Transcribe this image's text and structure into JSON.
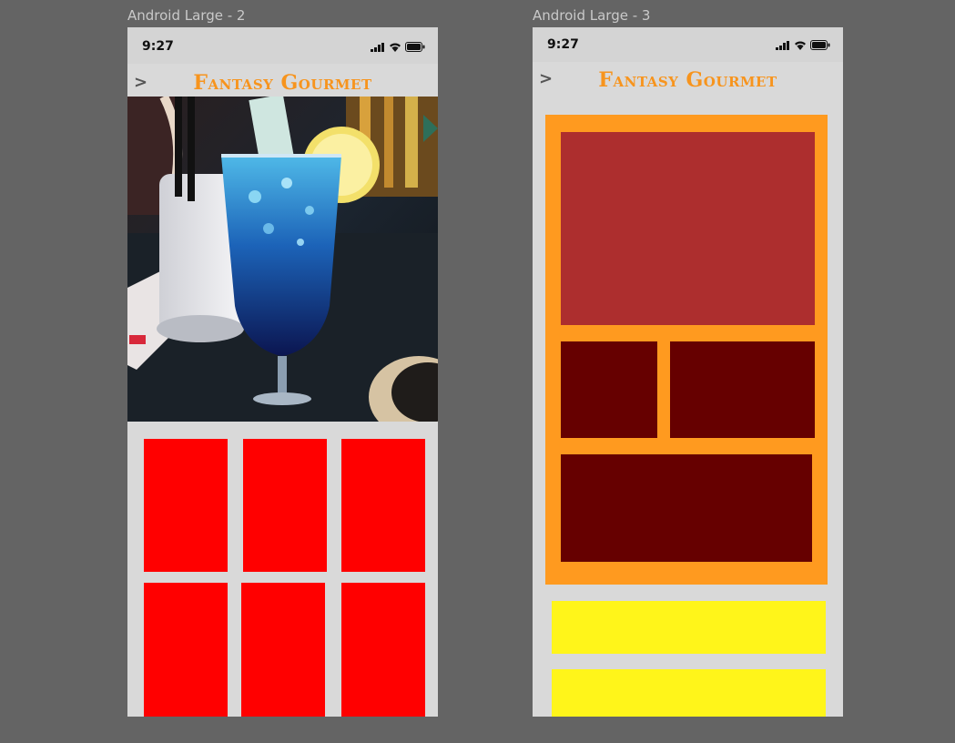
{
  "frames": [
    {
      "label": "Android Large - 2",
      "status_time": "9:27",
      "back_glyph": ">",
      "brand": "Fantasy Gourmet",
      "photo_icon": "cocktail-photo",
      "tile_color": "#ff0000",
      "tiles": 6
    },
    {
      "label": "Android Large - 3",
      "status_time": "9:27",
      "back_glyph": ">",
      "brand": "Fantasy Gourmet",
      "colors": {
        "card_border": "#ff9a1f",
        "hero": "#ad2e2e",
        "sub_blocks": "#660000",
        "bars": "#fff51a"
      }
    }
  ],
  "canvas_background": "#646464",
  "frame_background": "#d9d9d9",
  "accent": "#f7941d"
}
